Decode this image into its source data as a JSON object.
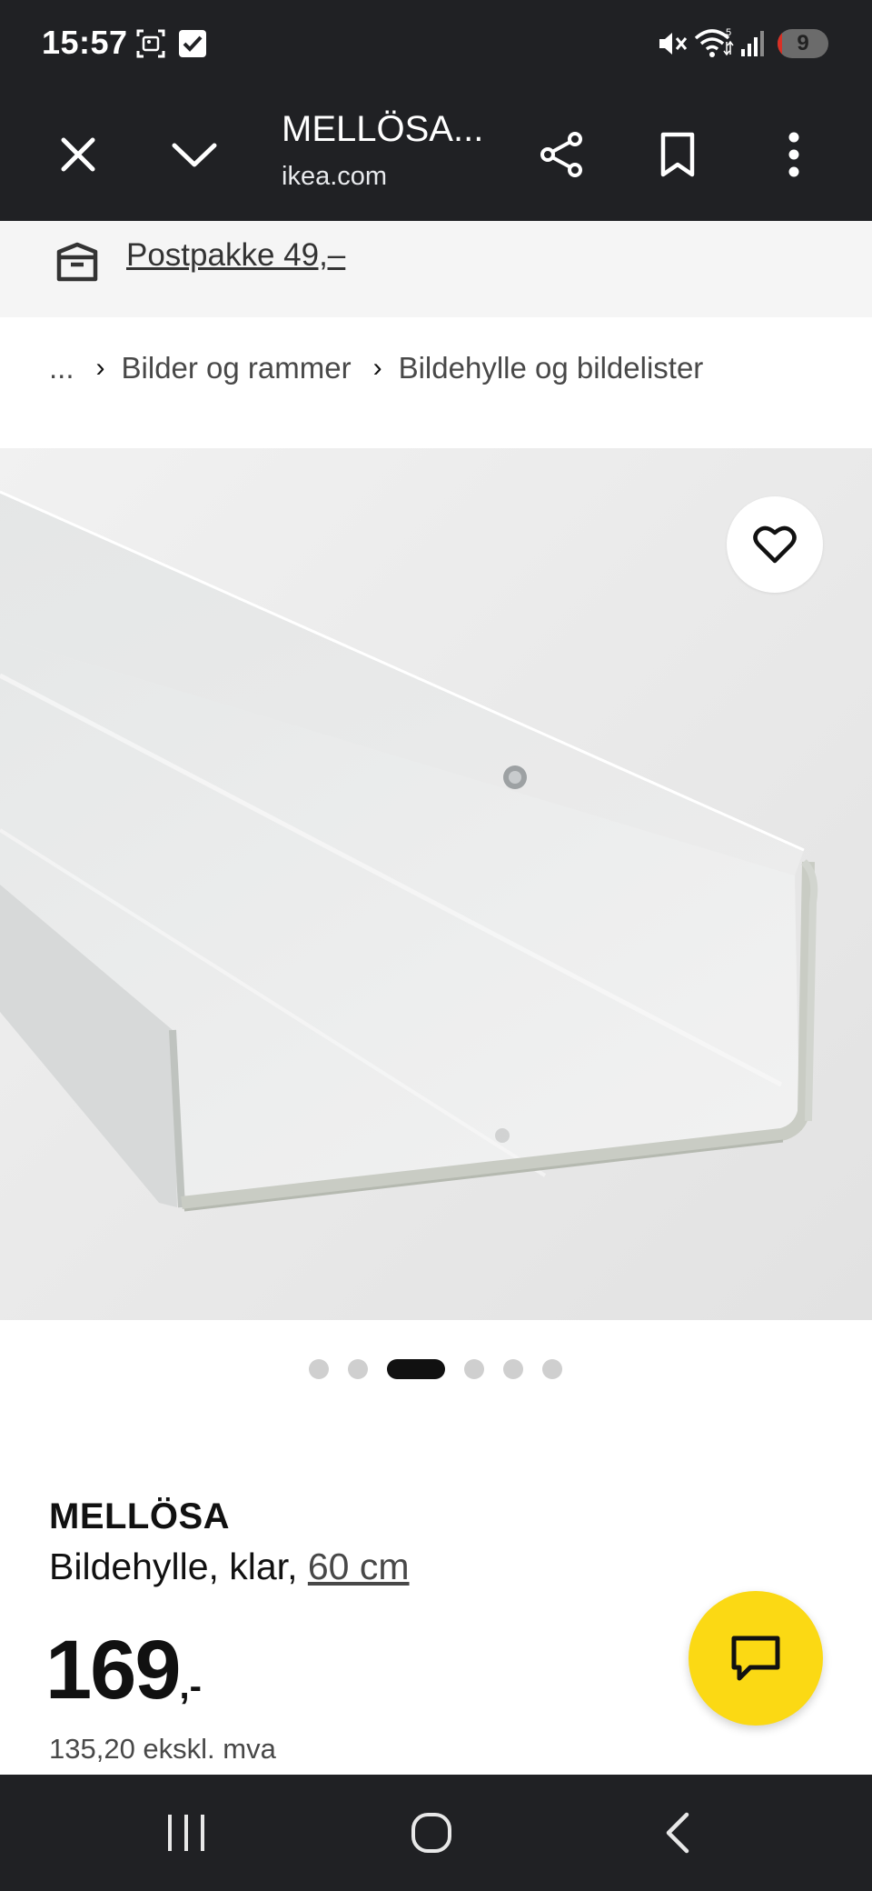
{
  "status_bar": {
    "time": "15:57",
    "battery_level": "9",
    "battery_fraction": 0.09,
    "icons": [
      "screenshot-icon",
      "checkbox-notification-icon",
      "mute-icon",
      "wifi-icon",
      "signal-icon",
      "battery-icon"
    ]
  },
  "toolbar": {
    "title": "MELLÖSA...",
    "host": "ikea.com",
    "icons": [
      "close-icon",
      "chevron-down-icon",
      "share-icon",
      "bookmark-icon",
      "more-vert-icon"
    ]
  },
  "shipping": {
    "label": "Postpakke 49,–",
    "icon": "parcel-icon"
  },
  "breadcrumb": {
    "ellipsis": "...",
    "items": [
      "Bilder og rammer",
      "Bildehylle og bildelister"
    ]
  },
  "gallery": {
    "dot_count": 6,
    "active_index": 2
  },
  "product": {
    "name": "MELLÖSA",
    "description": "Bildehylle, klar,",
    "size": "60 cm",
    "price_integer": "169",
    "price_suffix": ",-",
    "price_ex_vat": "135,20 ekskl. mva"
  },
  "colors": {
    "dark_bar": "#202124",
    "chat_button": "#fbd914",
    "active_dot": "#111111",
    "inactive_dot": "#cfcfcf"
  },
  "nav_bar": {
    "icons": [
      "recent-apps-icon",
      "home-icon",
      "back-icon"
    ]
  }
}
